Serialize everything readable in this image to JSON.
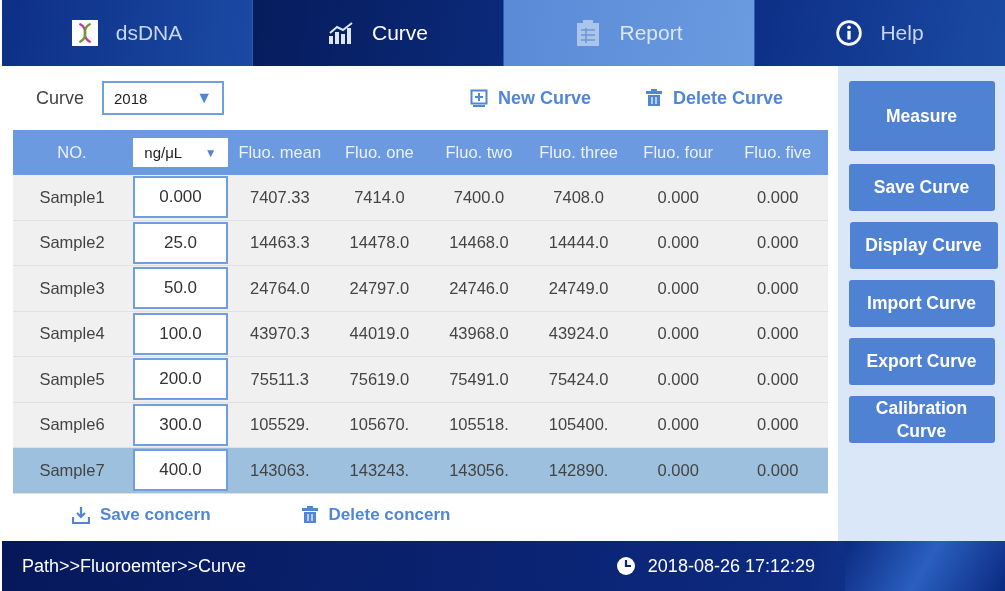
{
  "tabs": [
    {
      "label": "dsDNA",
      "selected": false,
      "disabled": false
    },
    {
      "label": "Curve",
      "selected": true,
      "disabled": false
    },
    {
      "label": "Report",
      "selected": false,
      "disabled": true
    },
    {
      "label": "Help",
      "selected": false,
      "disabled": false
    }
  ],
  "curve_select": {
    "label": "Curve",
    "value": "2018",
    "arrow": "▼"
  },
  "actions": [
    {
      "label": "New Curve"
    },
    {
      "label": "Delete Curve"
    }
  ],
  "table": {
    "columns": [
      "NO.",
      "ng/μL",
      "Fluo. mean",
      "Fluo. one",
      "Fluo. two",
      "Fluo. three",
      "Fluo. four",
      "Fluo. five"
    ],
    "unit_arrow": "▼",
    "rows": [
      {
        "cells": [
          "Sample1",
          "0.000",
          "7407.33",
          "7414.0",
          "7400.0",
          "7408.0",
          "0.000",
          "0.000"
        ],
        "selected": false
      },
      {
        "cells": [
          "Sample2",
          "25.0",
          "14463.3",
          "14478.0",
          "14468.0",
          "14444.0",
          "0.000",
          "0.000"
        ],
        "selected": false
      },
      {
        "cells": [
          "Sample3",
          "50.0",
          "24764.0",
          "24797.0",
          "24746.0",
          "24749.0",
          "0.000",
          "0.000"
        ],
        "selected": false
      },
      {
        "cells": [
          "Sample4",
          "100.0",
          "43970.3",
          "44019.0",
          "43968.0",
          "43924.0",
          "0.000",
          "0.000"
        ],
        "selected": false
      },
      {
        "cells": [
          "Sample5",
          "200.0",
          "75511.3",
          "75619.0",
          "75491.0",
          "75424.0",
          "0.000",
          "0.000"
        ],
        "selected": false
      },
      {
        "cells": [
          "Sample6",
          "300.0",
          "105529.",
          "105670.",
          "105518.",
          "105400.",
          "0.000",
          "0.000"
        ],
        "selected": false
      },
      {
        "cells": [
          "Sample7",
          "400.0",
          "143063.",
          "143243.",
          "143056.",
          "142890.",
          "0.000",
          "0.000"
        ],
        "selected": true
      }
    ]
  },
  "bottom_actions": [
    {
      "label": "Save concern"
    },
    {
      "label": "Delete concern"
    }
  ],
  "side_buttons": [
    "Measure",
    "Save Curve",
    "Display Curve",
    "Import Curve",
    "Export Curve",
    "Calibration Curve"
  ],
  "status_bar": {
    "path": "Path>>Fluoroemter>>Curve",
    "datetime": "2018-08-26 17:12:29"
  }
}
